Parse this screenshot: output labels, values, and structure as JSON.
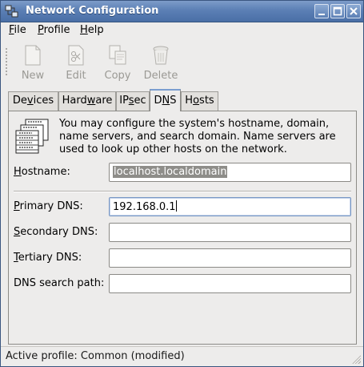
{
  "window": {
    "title": "Network Configuration"
  },
  "menu": [
    {
      "label": "File",
      "mnemonic": "F",
      "rest": "ile"
    },
    {
      "label": "Profile",
      "mnemonic": "P",
      "rest": "rofile"
    },
    {
      "label": "Help",
      "mnemonic": "H",
      "rest": "elp"
    }
  ],
  "toolbar": {
    "new": "New",
    "edit": "Edit",
    "copy": "Copy",
    "delete": "Delete"
  },
  "tabs": [
    {
      "pre": "De",
      "mn": "v",
      "post": "ices"
    },
    {
      "pre": "Hard",
      "mn": "w",
      "post": "are"
    },
    {
      "pre": "IP",
      "mn": "s",
      "post": "ec"
    },
    {
      "pre": "D",
      "mn": "N",
      "post": "S"
    },
    {
      "pre": "H",
      "mn": "o",
      "post": "sts"
    }
  ],
  "dns": {
    "info": "You may configure the system's hostname, domain, name servers, and search domain. Name servers are used to look up other hosts on the network.",
    "hostname_label": {
      "mn": "H",
      "rest": "ostname:"
    },
    "hostname_value": "localhost.localdomain",
    "primary_label": {
      "mn": "P",
      "rest": "rimary DNS:"
    },
    "primary_value": "192.168.0.1",
    "secondary_label": {
      "mn": "S",
      "rest": "econdary DNS:"
    },
    "secondary_value": "",
    "tertiary_label": {
      "mn": "T",
      "rest": "ertiary DNS:"
    },
    "tertiary_value": "",
    "search_label": "DNS search path:",
    "search_value": ""
  },
  "status": "Active profile: Common (modified)",
  "colors": {
    "titlebar": "#5b7fb5",
    "selection": "#8e8d89",
    "tab_accent": "#7b9ed0"
  }
}
